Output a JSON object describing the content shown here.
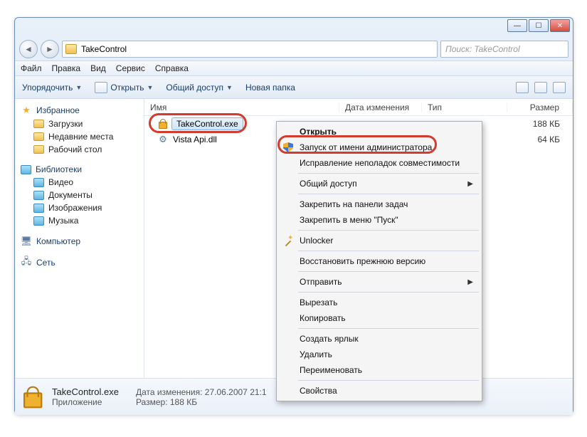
{
  "window": {
    "address": "TakeControl",
    "search_placeholder": "Поиск: TakeControl"
  },
  "menubar": [
    "Файл",
    "Правка",
    "Вид",
    "Сервис",
    "Справка"
  ],
  "toolbar": {
    "organize": "Упорядочить",
    "open": "Открыть",
    "share": "Общий доступ",
    "newfolder": "Новая папка"
  },
  "sidebar": {
    "favorites": {
      "title": "Избранное",
      "items": [
        "Загрузки",
        "Недавние места",
        "Рабочий стол"
      ]
    },
    "libraries": {
      "title": "Библиотеки",
      "items": [
        "Видео",
        "Документы",
        "Изображения",
        "Музыка"
      ]
    },
    "computer": "Компьютер",
    "network": "Сеть"
  },
  "columns": {
    "name": "Имя",
    "date": "Дата изменения",
    "type": "Тип",
    "size": "Размер"
  },
  "files": [
    {
      "name": "TakeControl.exe",
      "size": "188 КБ"
    },
    {
      "name": "Vista Api.dll",
      "size": "64 КБ"
    }
  ],
  "context_menu": {
    "open": "Открыть",
    "runas": "Запуск от имени администратора",
    "compat": "Исправление неполадок совместимости",
    "share": "Общий доступ",
    "pin_taskbar": "Закрепить на панели задач",
    "pin_start": "Закрепить в меню \"Пуск\"",
    "unlocker": "Unlocker",
    "restore": "Восстановить прежнюю версию",
    "sendto": "Отправить",
    "cut": "Вырезать",
    "copy": "Копировать",
    "shortcut": "Создать ярлык",
    "delete": "Удалить",
    "rename": "Переименовать",
    "properties": "Свойства"
  },
  "details": {
    "filename": "TakeControl.exe",
    "type_label": "Приложение",
    "date_label": "Дата изменения:",
    "date_value": "27.06.2007 21:1",
    "size_label": "Размер:",
    "size_value": "188 КБ"
  }
}
